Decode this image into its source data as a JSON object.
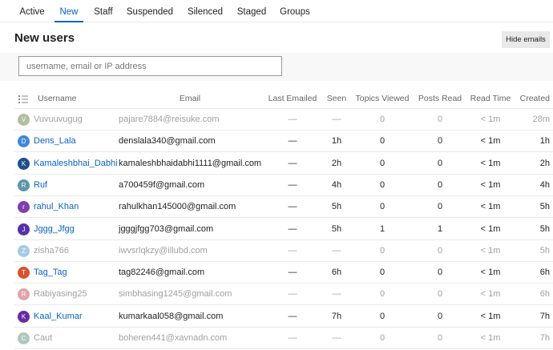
{
  "tabs": [
    "Active",
    "New",
    "Staff",
    "Suspended",
    "Silenced",
    "Staged",
    "Groups"
  ],
  "active_tab": "New",
  "page_title": "New users",
  "hide_emails_label": "Hide emails",
  "search": {
    "placeholder": "username, email or IP address",
    "value": ""
  },
  "columns": [
    "Username",
    "Email",
    "Last Emailed",
    "Seen",
    "Topics Viewed",
    "Posts Read",
    "Read Time",
    "Created"
  ],
  "accent_color": "#0a63c9",
  "users": [
    {
      "initial": "V",
      "avatar_color": "#718a48",
      "username": "Vuvuuvugug",
      "email": "pajare7884@reisuke.com",
      "last_emailed": "—",
      "seen": "—",
      "topics_viewed": "0",
      "posts_read": "0",
      "read_time": "< 1m",
      "created": "28m",
      "dim": true
    },
    {
      "initial": "D",
      "avatar_color": "#3f87d6",
      "username": "Dens_Lala",
      "email": "denslala340@gmail.com",
      "last_emailed": "—",
      "seen": "1h",
      "topics_viewed": "0",
      "posts_read": "0",
      "read_time": "< 1m",
      "created": "1h",
      "dim": false
    },
    {
      "initial": "K",
      "avatar_color": "#1f4e8c",
      "username": "Kamaleshbhai_Dabhi",
      "email": "kamaleshbhaidabhi1111@gmail.com",
      "last_emailed": "—",
      "seen": "2h",
      "topics_viewed": "0",
      "posts_read": "0",
      "read_time": "< 1m",
      "created": "2h",
      "dim": false
    },
    {
      "initial": "R",
      "avatar_color": "#5d96a9",
      "username": "Ruf",
      "email": "a700459f@gmail.com",
      "last_emailed": "—",
      "seen": "4h",
      "topics_viewed": "0",
      "posts_read": "0",
      "read_time": "< 1m",
      "created": "4h",
      "dim": false
    },
    {
      "initial": "r",
      "avatar_color": "#7f3fb0",
      "username": "rahul_Khan",
      "email": "rahulkhan145000@gmail.com",
      "last_emailed": "—",
      "seen": "5h",
      "topics_viewed": "0",
      "posts_read": "0",
      "read_time": "< 1m",
      "created": "5h",
      "dim": false
    },
    {
      "initial": "J",
      "avatar_color": "#5731a8",
      "username": "Jggg_Jfgg",
      "email": "jgggjfgg703@gmail.com",
      "last_emailed": "—",
      "seen": "5h",
      "topics_viewed": "1",
      "posts_read": "1",
      "read_time": "< 1m",
      "created": "5h",
      "dim": false
    },
    {
      "initial": "Z",
      "avatar_color": "#5ea0cf",
      "username": "zisha766",
      "email": "iwvsrlqkzy@illubd.com",
      "last_emailed": "—",
      "seen": "—",
      "topics_viewed": "0",
      "posts_read": "0",
      "read_time": "< 1m",
      "created": "5h",
      "dim": true
    },
    {
      "initial": "T",
      "avatar_color": "#d5552e",
      "username": "Tag_Tag",
      "email": "tag82246@gmail.com",
      "last_emailed": "—",
      "seen": "6h",
      "topics_viewed": "0",
      "posts_read": "0",
      "read_time": "< 1m",
      "created": "6h",
      "dim": false
    },
    {
      "initial": "R",
      "avatar_color": "#c75b6a",
      "username": "Rabiyasing25",
      "email": "simbhasing1245@gmail.com",
      "last_emailed": "—",
      "seen": "—",
      "topics_viewed": "0",
      "posts_read": "0",
      "read_time": "< 1m",
      "created": "6h",
      "dim": true
    },
    {
      "initial": "K",
      "avatar_color": "#6a2aa3",
      "username": "Kaal_Kumar",
      "email": "kumarkaal058@gmail.com",
      "last_emailed": "—",
      "seen": "7h",
      "topics_viewed": "0",
      "posts_read": "0",
      "read_time": "< 1m",
      "created": "7h",
      "dim": false
    },
    {
      "initial": "C",
      "avatar_color": "#6f9c86",
      "username": "Caut",
      "email": "boheren441@xavnadn.com",
      "last_emailed": "—",
      "seen": "—",
      "topics_viewed": "0",
      "posts_read": "0",
      "read_time": "< 1m",
      "created": "7h",
      "dim": true
    }
  ]
}
